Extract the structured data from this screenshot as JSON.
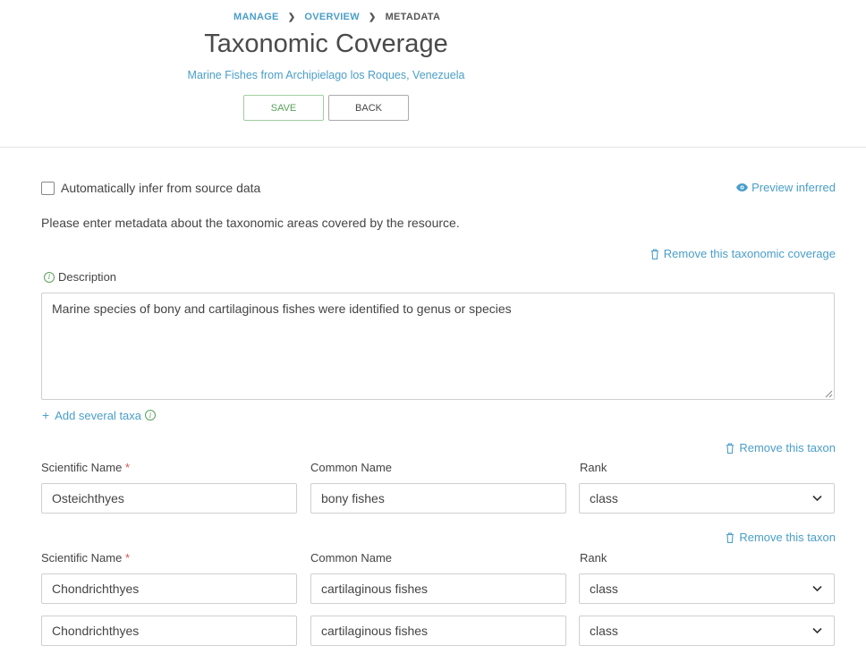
{
  "breadcrumb": {
    "manage": "MANAGE",
    "overview": "OVERVIEW",
    "current": "METADATA"
  },
  "page": {
    "title": "Taxonomic Coverage",
    "subtitle": "Marine Fishes from Archipielago los Roques, Venezuela"
  },
  "actions": {
    "save_label": "SAVE",
    "back_label": "BACK"
  },
  "infer": {
    "label": "Automatically infer from source data",
    "checked": false
  },
  "preview_label": "Preview inferred",
  "intro": "Please enter metadata about the taxonomic areas covered by the resource.",
  "coverage": {
    "remove_label": "Remove this taxonomic coverage",
    "description_label": "Description",
    "description_value": "Marine species of bony and cartilaginous fishes were identified to genus or species",
    "add_several_label": "Add several taxa"
  },
  "taxa_labels": {
    "scientific": "Scientific Name",
    "common": "Common Name",
    "rank": "Rank",
    "required_mark": "*",
    "remove": "Remove this taxon"
  },
  "taxa": [
    {
      "scientific": "Osteichthyes",
      "common": "bony fishes",
      "rank": "class"
    },
    {
      "scientific": "Chondrichthyes",
      "common": "cartilaginous fishes",
      "rank": "class"
    },
    {
      "scientific": "Chondrichthyes",
      "common": "cartilaginous fishes",
      "rank": "class"
    }
  ],
  "colors": {
    "link": "#4a9ec9",
    "save": "#5aa15b",
    "required": "#d9534f"
  },
  "icons": [
    "chevron-right-icon",
    "eye-icon",
    "trash-icon",
    "info-icon",
    "plus-icon",
    "chevron-down-icon",
    "resize-grip-icon"
  ]
}
